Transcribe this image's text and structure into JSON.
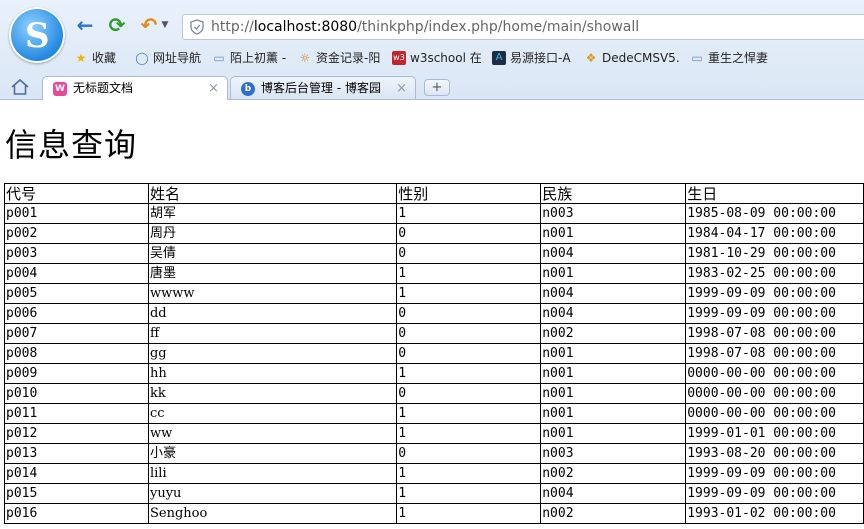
{
  "browser": {
    "url_prefix": "http://",
    "url_host": "localhost:8080",
    "url_path": "/thinkphp/index.php/home/main/showall",
    "bookmarks": [
      {
        "label": "收藏",
        "icon": "star-icon"
      },
      {
        "label": "网址导航",
        "icon": "globe-icon"
      },
      {
        "label": "陌上初薰 -",
        "icon": "page-icon"
      },
      {
        "label": "资金记录-阳",
        "icon": "sun-icon"
      },
      {
        "label": "w3school 在",
        "icon": "w3-icon"
      },
      {
        "label": "易源接口-A",
        "icon": "a-icon"
      },
      {
        "label": "DedeCMSV5.",
        "icon": "cube-icon"
      },
      {
        "label": "重生之悍妻",
        "icon": "page-icon"
      }
    ],
    "tabs": [
      {
        "label": "无标题文档",
        "active": true
      },
      {
        "label": "博客后台管理 - 博客园",
        "active": false
      }
    ],
    "new_tab_label": "+",
    "close_symbol": "×"
  },
  "page": {
    "title": "信息查询",
    "columns": [
      "代号",
      "姓名",
      "性别",
      "民族",
      "生日"
    ],
    "rows": [
      [
        "p001",
        "胡军",
        "1",
        "n003",
        "1985-08-09 00:00:00"
      ],
      [
        "p002",
        "周丹",
        "0",
        "n001",
        "1984-04-17 00:00:00"
      ],
      [
        "p003",
        "吴倩",
        "0",
        "n004",
        "1981-10-29 00:00:00"
      ],
      [
        "p004",
        "唐墨",
        "1",
        "n001",
        "1983-02-25 00:00:00"
      ],
      [
        "p005",
        "wwww",
        "1",
        "n004",
        "1999-09-09 00:00:00"
      ],
      [
        "p006",
        "dd",
        "0",
        "n004",
        "1999-09-09 00:00:00"
      ],
      [
        "p007",
        "ff",
        "0",
        "n002",
        "1998-07-08 00:00:00"
      ],
      [
        "p008",
        "gg",
        "0",
        "n001",
        "1998-07-08 00:00:00"
      ],
      [
        "p009",
        "hh",
        "1",
        "n001",
        "0000-00-00 00:00:00"
      ],
      [
        "p010",
        "kk",
        "0",
        "n001",
        "0000-00-00 00:00:00"
      ],
      [
        "p011",
        "cc",
        "1",
        "n001",
        "0000-00-00 00:00:00"
      ],
      [
        "p012",
        "ww",
        "1",
        "n001",
        "1999-01-01 00:00:00"
      ],
      [
        "p013",
        "小豪",
        "0",
        "n003",
        "1993-08-20 00:00:00"
      ],
      [
        "p014",
        "lili",
        "1",
        "n002",
        "1999-09-09 00:00:00"
      ],
      [
        "p015",
        "yuyu",
        "1",
        "n004",
        "1999-09-09 00:00:00"
      ],
      [
        "p016",
        "Senghoo",
        "1",
        "n002",
        "1993-01-02 00:00:00"
      ]
    ]
  }
}
